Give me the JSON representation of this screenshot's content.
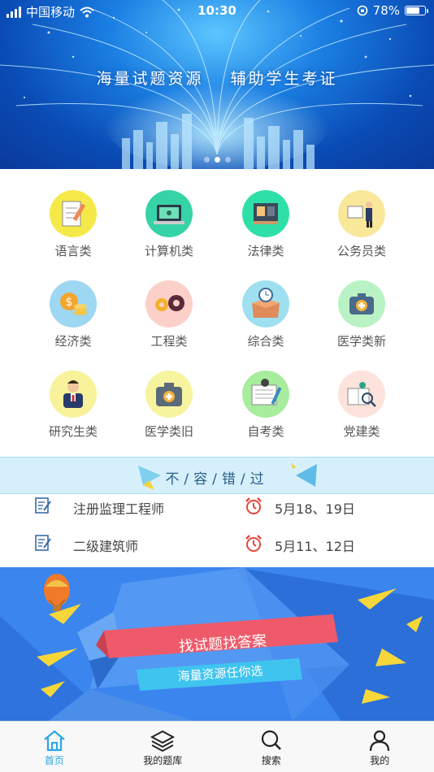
{
  "status_bar": {
    "carrier": "中国移动",
    "time": "10:30",
    "battery_text": "78%",
    "battery_level": 0.78
  },
  "banner": {
    "slogan_left": "海量试题资源",
    "slogan_right": "辅助学生考证",
    "page_count": 3,
    "active_page": 2
  },
  "categories": [
    {
      "label": "语言类",
      "icon": "document-pencil-icon",
      "color": "#f5e94a"
    },
    {
      "label": "计算机类",
      "icon": "laptop-icon",
      "color": "#35d3a6"
    },
    {
      "label": "法律类",
      "icon": "law-office-icon",
      "color": "#2ee0a8"
    },
    {
      "label": "公务员类",
      "icon": "businessman-board-icon",
      "color": "#f9e79a"
    },
    {
      "label": "经济类",
      "icon": "money-coins-icon",
      "color": "#9ed7f2"
    },
    {
      "label": "工程类",
      "icon": "gears-icon",
      "color": "#fbd0c8"
    },
    {
      "label": "综合类",
      "icon": "box-clock-icon",
      "color": "#9fe0f0"
    },
    {
      "label": "医学类新",
      "icon": "medical-kit-icon",
      "color": "#b9f2c4"
    },
    {
      "label": "研究生类",
      "icon": "graduate-person-icon",
      "color": "#f8f29a"
    },
    {
      "label": "医学类旧",
      "icon": "medical-bag-icon",
      "color": "#f6f49e"
    },
    {
      "label": "自考类",
      "icon": "notebook-icon",
      "color": "#a8ec9e"
    },
    {
      "label": "党建类",
      "icon": "book-magnifier-icon",
      "color": "#fde3dc"
    }
  ],
  "strip": {
    "title": "不/容/错/过"
  },
  "exams": [
    {
      "name": "注册监理工程师",
      "date": "5月18、19日"
    },
    {
      "name": "二级建筑师",
      "date": "5月11、12日"
    }
  ],
  "promo": {
    "title": "找试题找答案",
    "subtitle": "海量资源任你选"
  },
  "tabs": [
    {
      "label": "首页",
      "icon": "home-icon",
      "active": true
    },
    {
      "label": "我的题库",
      "icon": "layers-icon",
      "active": false
    },
    {
      "label": "搜索",
      "icon": "search-icon",
      "active": false
    },
    {
      "label": "我的",
      "icon": "user-icon",
      "active": false
    }
  ],
  "colors": {
    "accent": "#29a6e6",
    "banner_blue": "#1b7fe3",
    "strip_bg": "#d6f0fb",
    "alarm_red": "#e8463c",
    "promo_ribbon": "#ef5a6a"
  }
}
